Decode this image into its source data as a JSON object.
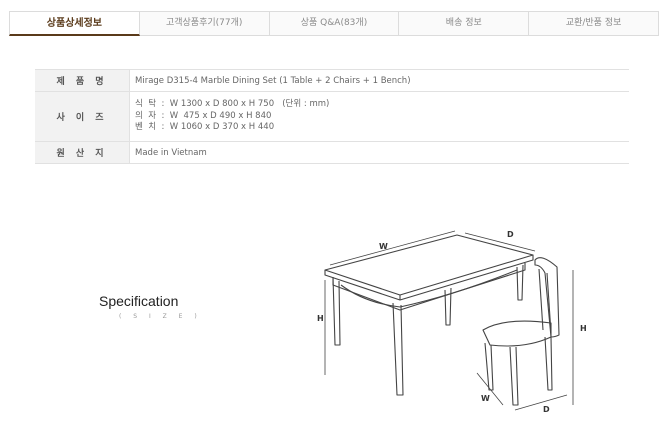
{
  "tabs": [
    {
      "label": "상품상세정보"
    },
    {
      "label": "고객상품후기(77개)"
    },
    {
      "label": "상품 Q&A(83개)"
    },
    {
      "label": "배송 정보"
    },
    {
      "label": "교환/반품 정보"
    }
  ],
  "spec": {
    "product_label": "제 품 명",
    "product_value": "Mirage D315-4  Marble Dining Set (1 Table + 2 Chairs + 1 Bench)",
    "size_label": "사 이 즈",
    "size_lines": [
      "식  탁  :  W 1300 x D 800 x H 750   (단위 : mm)",
      "의  자  :  W  475 x D 490 x H 840",
      "벤  치  :  W 1060 x D 370 x H 440"
    ],
    "origin_label": "원 산 지",
    "origin_value": "Made in Vietnam"
  },
  "specification": {
    "title": "Specification",
    "subtitle": "( S I Z E )"
  },
  "diagram": {
    "labels": {
      "table_w": "W",
      "table_d": "D",
      "table_h": "H",
      "chair_h": "H",
      "chair_w": "W",
      "chair_d": "D"
    }
  }
}
